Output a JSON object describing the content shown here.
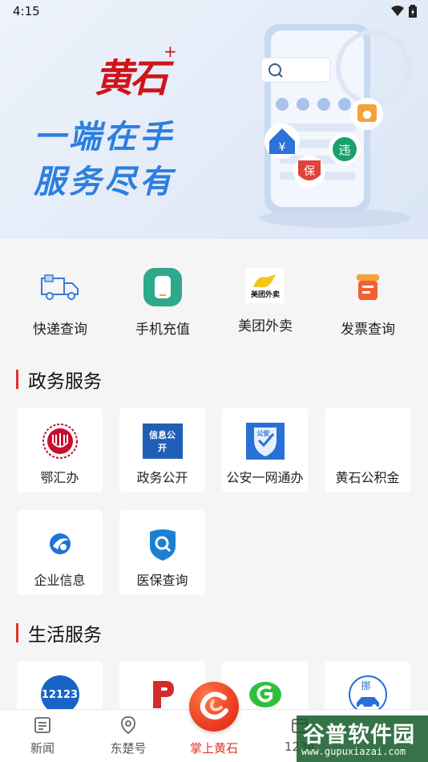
{
  "status": {
    "time": "4:15"
  },
  "banner": {
    "logo_text": "黄石",
    "logo_plus": "+",
    "slogan_line1": "一端在手",
    "slogan_line2": "服务尽有",
    "badges": {
      "yuan": "¥",
      "violation": "违",
      "insurance": "保"
    }
  },
  "quick_actions": [
    {
      "label": "快递查询",
      "icon": "delivery-truck-icon"
    },
    {
      "label": "手机充值",
      "icon": "phone-recharge-icon"
    },
    {
      "label": "美团外卖",
      "icon": "meituan-logo-icon",
      "icon_text": "美团外卖"
    },
    {
      "label": "发票查询",
      "icon": "invoice-icon"
    }
  ],
  "gov_section": {
    "title": "政务服务",
    "items": [
      {
        "label": "鄂汇办",
        "icon": "ehuiban-logo-icon"
      },
      {
        "label": "政务公开",
        "icon": "info-public-icon",
        "icon_text": "信息公开"
      },
      {
        "label": "公安一网通办",
        "icon": "police-shield-icon",
        "icon_text": "公安"
      },
      {
        "label": "黄石公积金",
        "icon": ""
      },
      {
        "label": "企业信息",
        "icon": "enterprise-info-icon"
      },
      {
        "label": "医保查询",
        "icon": "medical-insurance-search-icon"
      }
    ]
  },
  "life_section": {
    "title": "生活服务",
    "items": [
      {
        "label": "",
        "icon": "12123-traffic-icon",
        "icon_text": "12123"
      },
      {
        "label": "",
        "icon": "parking-p-icon"
      },
      {
        "label": "",
        "icon": "green-g-logo-icon"
      },
      {
        "label": "",
        "icon": "move-car-icon",
        "icon_text": "挪"
      }
    ]
  },
  "tabbar": {
    "tabs": [
      {
        "label": "新闻",
        "icon": "news-icon"
      },
      {
        "label": "东楚号",
        "icon": "location-pin-icon"
      },
      {
        "label": "掌上黄石",
        "icon": "home-center-icon",
        "active": true
      },
      {
        "label": "1234",
        "icon": "calendar-icon"
      }
    ]
  },
  "watermark": {
    "title": "谷普软件园",
    "url": "www.gupuxiazai.com"
  },
  "colors": {
    "accent": "#e0322a",
    "banner_blue": "#2c7fe0",
    "bg": "#f5f5f5"
  }
}
